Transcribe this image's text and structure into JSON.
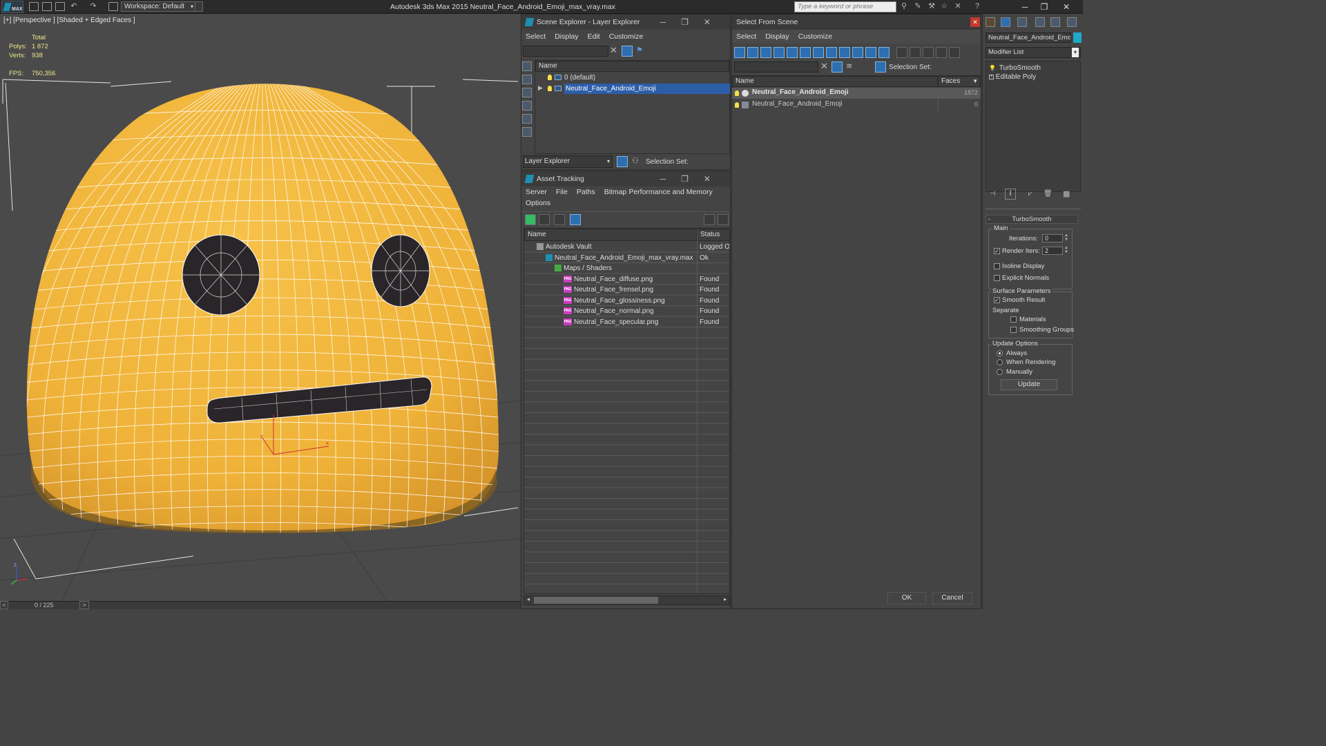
{
  "app": {
    "title": "Autodesk 3ds Max  2015     Neutral_Face_Android_Emoji_max_vray.max",
    "logo_text": "MAX",
    "workspace": "Workspace: Default",
    "search_placeholder": "Type a keyword or phrase"
  },
  "viewport": {
    "label": "[+] [Perspective ] [Shaded + Edged Faces ]",
    "stats": {
      "total_label": "Total",
      "polys_label": "Polys:",
      "polys_value": "1 872",
      "verts_label": "Verts:",
      "verts_value": "938",
      "fps_label": "FPS:",
      "fps_value": "750,356"
    },
    "gizmo": {
      "x": "x",
      "y": "y",
      "z": "z"
    },
    "colors": {
      "face": "#f1b43a",
      "background": "#4a4a4a"
    }
  },
  "timeline": {
    "frame": "0 / 225",
    "prev": "<",
    "next": ">"
  },
  "scene_explorer": {
    "title": "Scene Explorer - Layer Explorer",
    "menu": [
      "Select",
      "Display",
      "Edit",
      "Customize"
    ],
    "column_name": "Name",
    "rows": [
      {
        "label": "0 (default)",
        "selected": false
      },
      {
        "label": "Neutral_Face_Android_Emoji",
        "selected": true
      }
    ],
    "footer_dropdown": "Layer Explorer",
    "selection_set_label": "Selection Set:"
  },
  "asset_tracking": {
    "title": "Asset Tracking",
    "menu": [
      "Server",
      "File",
      "Paths",
      "Bitmap Performance and Memory"
    ],
    "menu2": "Options",
    "col_name": "Name",
    "col_status": "Status",
    "rows": [
      {
        "name": "Autodesk Vault",
        "status": "Logged Ou",
        "indent": 0,
        "icon": "vault"
      },
      {
        "name": "Neutral_Face_Android_Emoji_max_vray.max",
        "status": "Ok",
        "indent": 1,
        "icon": "max"
      },
      {
        "name": "Maps / Shaders",
        "status": "",
        "indent": 2,
        "icon": "maps"
      },
      {
        "name": "Neutral_Face_diffuse.png",
        "status": "Found",
        "indent": 3,
        "icon": "png"
      },
      {
        "name": "Neutral_Face_frensel.png",
        "status": "Found",
        "indent": 3,
        "icon": "png"
      },
      {
        "name": "Neutral_Face_glossiness.png",
        "status": "Found",
        "indent": 3,
        "icon": "png"
      },
      {
        "name": "Neutral_Face_normal.png",
        "status": "Found",
        "indent": 3,
        "icon": "png"
      },
      {
        "name": "Neutral_Face_specular.png",
        "status": "Found",
        "indent": 3,
        "icon": "png"
      }
    ],
    "png_badge": "PNG"
  },
  "select_from_scene": {
    "title": "Select From Scene",
    "menu": [
      "Select",
      "Display",
      "Customize"
    ],
    "selection_set_label": "Selection Set:",
    "col_name": "Name",
    "col_faces": "Faces",
    "rows": [
      {
        "name": "Neutral_Face_Android_Emoji",
        "faces": "1872",
        "bold": true
      },
      {
        "name": "Neutral_Face_Android_Emoji",
        "faces": "0",
        "bold": false
      }
    ],
    "ok": "OK",
    "cancel": "Cancel"
  },
  "modifier_panel": {
    "object_name": "Neutral_Face_Android_Emoji",
    "modifier_list": "Modifier List",
    "stack": [
      "TurboSmooth",
      "Editable Poly"
    ],
    "rollout_title": "TurboSmooth",
    "main_label": "Main",
    "iterations_label": "Iterations:",
    "iterations_value": "0",
    "render_iters_label": "Render Iters:",
    "render_iters_value": "2",
    "isoline": "Isoline Display",
    "explicit_normals": "Explicit Normals",
    "surface_params": "Surface Parameters",
    "smooth_result": "Smooth Result",
    "separate": "Separate",
    "materials": "Materials",
    "smoothing_groups": "Smoothing Groups",
    "update_options": "Update Options",
    "always": "Always",
    "when_rendering": "When Rendering",
    "manually": "Manually",
    "update_btn": "Update"
  }
}
